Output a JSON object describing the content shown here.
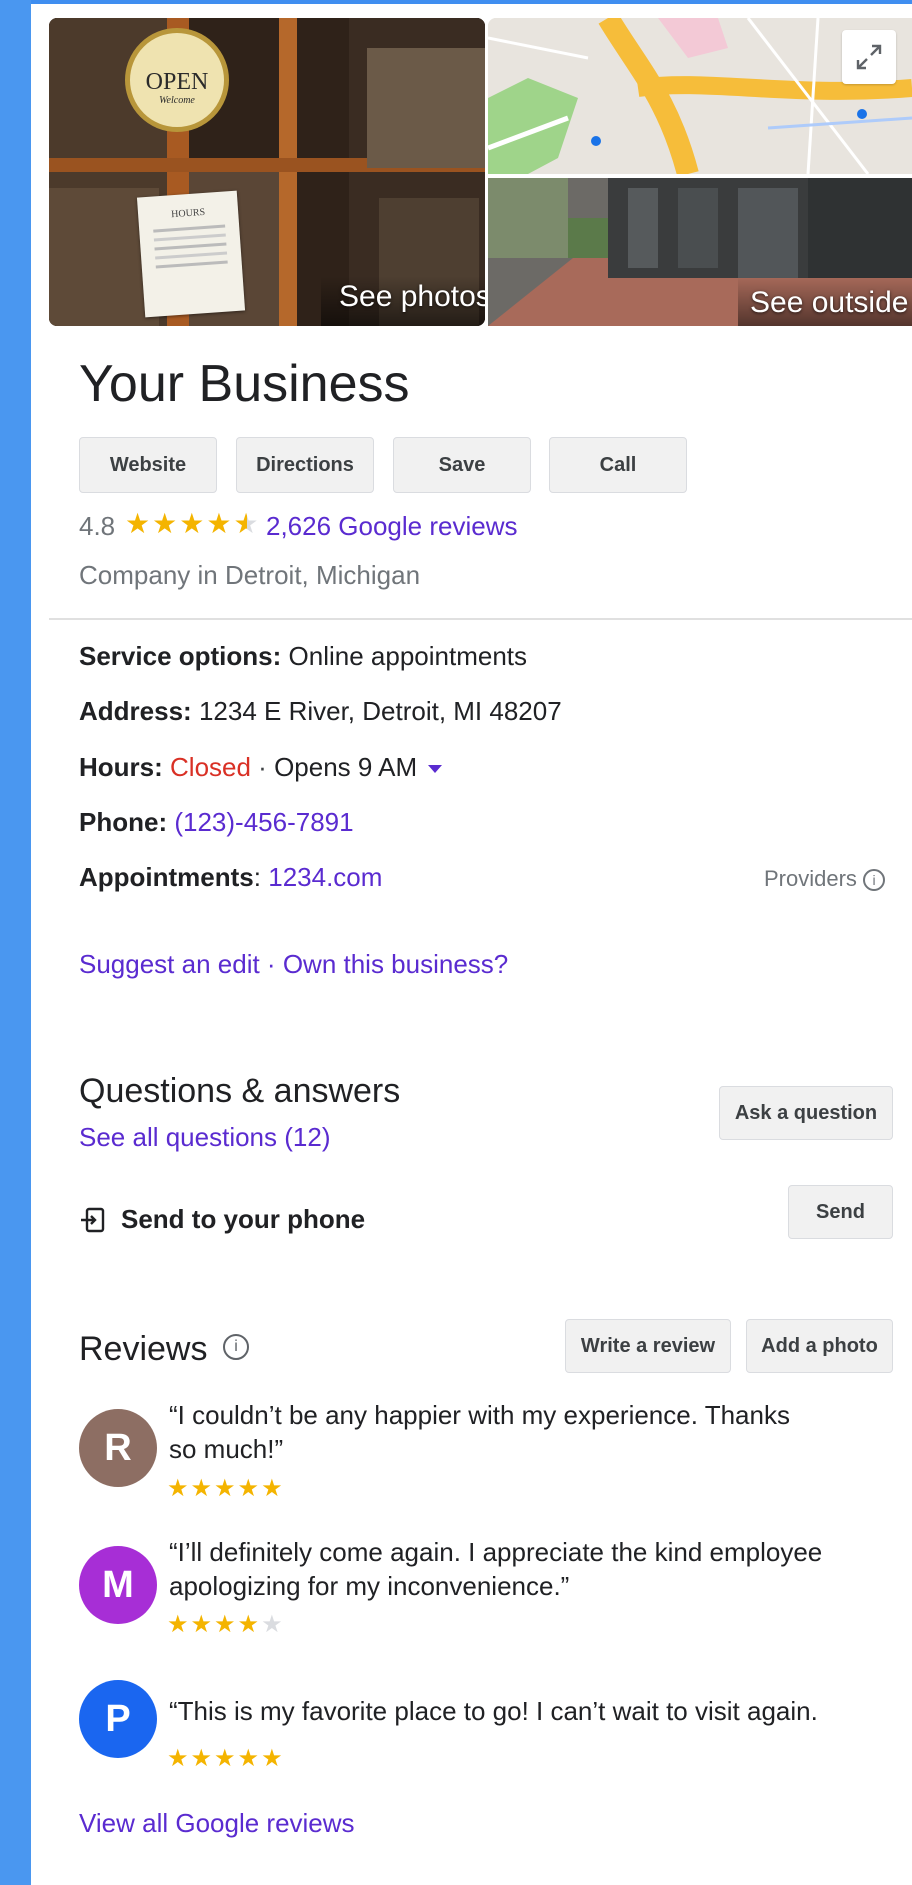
{
  "photos": {
    "main_label": "See photos",
    "outside_label": "See outside",
    "open_sign": "OPEN",
    "open_sign_sub": "Welcome",
    "hours_card": "HOURS"
  },
  "business": {
    "name": "Your Business",
    "rating": "4.8",
    "rating_stars": 4.5,
    "reviews_link": "2,626 Google reviews",
    "category": "Company in Detroit, Michigan"
  },
  "actions": [
    "Website",
    "Directions",
    "Save",
    "Call"
  ],
  "details": {
    "service_label": "Service options:",
    "service_value": "Online appointments",
    "address_label": "Address:",
    "address_value": "1234 E River, Detroit, MI 48207",
    "hours_label": "Hours:",
    "hours_status": "Closed",
    "hours_sep": " · ",
    "hours_opens": "Opens 9 AM",
    "phone_label": "Phone:",
    "phone_value": "(123)-456-7891",
    "appt_label": "Appointments",
    "appt_colon": ":",
    "appt_value": "1234.com",
    "providers": "Providers"
  },
  "edit": {
    "suggest": "Suggest an edit",
    "sep": " · ",
    "own": "Own this business?"
  },
  "qa": {
    "title": "Questions & answers",
    "see_all": "See all questions (12)",
    "ask_button": "Ask a question"
  },
  "send": {
    "label": "Send to your phone",
    "button": "Send"
  },
  "reviews": {
    "title": "Reviews",
    "write_button": "Write a review",
    "add_photo_button": "Add a photo",
    "items": [
      {
        "initial": "R",
        "color": "#8d6e63",
        "text_line1": "“I couldn’t be any happier with my experience. Thanks",
        "text_line2": "so much!”",
        "stars": 5
      },
      {
        "initial": "M",
        "color": "#a72ed6",
        "text_line1": "“I’ll definitely come again. I appreciate the kind employee",
        "text_line2": "apologizing for my inconvenience.”",
        "stars": 4
      },
      {
        "initial": "P",
        "color": "#1a66f0",
        "text_line1": "“This is my favorite place to go! I can’t wait to visit again.",
        "text_line2": "",
        "stars": 5
      }
    ],
    "view_all": "View all Google reviews"
  },
  "colors": {
    "link": "#5a2bd0",
    "closed": "#d93025",
    "star": "#f4b400",
    "star_empty": "#dadce0",
    "page_bg": "#4a97f0"
  }
}
